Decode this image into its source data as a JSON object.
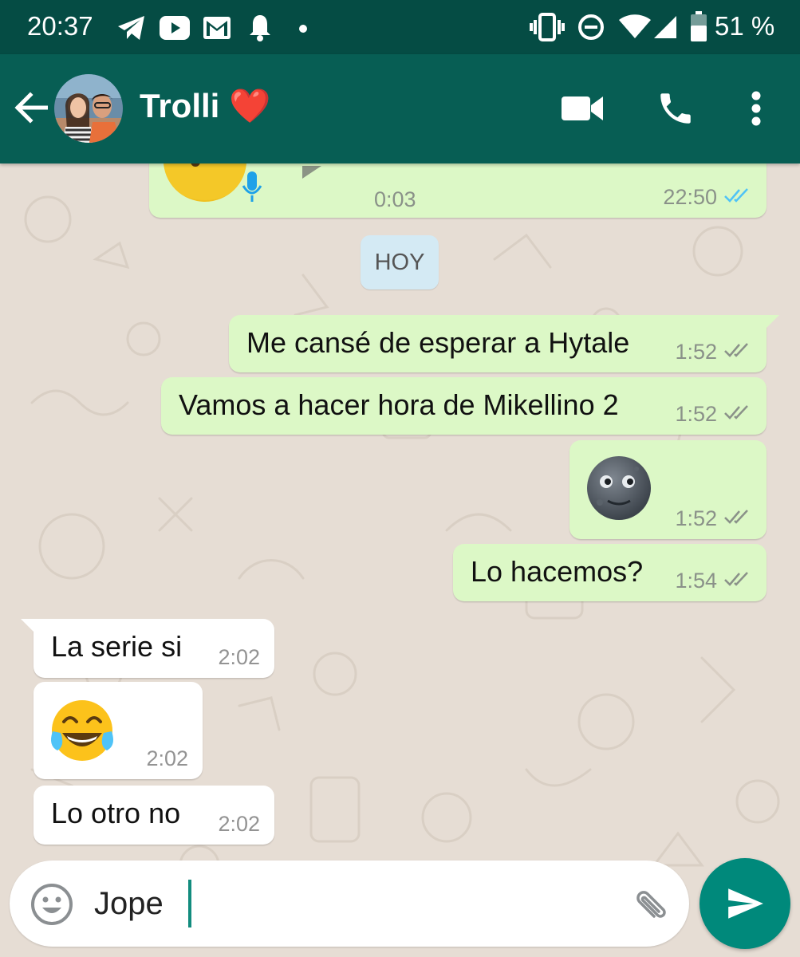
{
  "status_bar": {
    "time": "20:37",
    "battery": "51 %",
    "icons": [
      "telegram-icon",
      "youtube-icon",
      "gmail-icon",
      "bell-icon",
      "dot-icon",
      "vibrate-icon",
      "do-not-disturb-icon",
      "wifi-icon",
      "signal-icon",
      "battery-icon"
    ]
  },
  "header": {
    "contact_name": "Trolli",
    "contact_emoji": "❤️",
    "icons": [
      "back-arrow-icon",
      "video-call-icon",
      "phone-icon",
      "more-vert-icon"
    ]
  },
  "chat": {
    "voice_note": {
      "duration": "0:03",
      "time": "22:50",
      "status": "read"
    },
    "date_chip": "HOY",
    "messages": [
      {
        "direction": "outgoing",
        "text": "Me cansé de esperar a Hytale",
        "time": "1:52",
        "status": "delivered"
      },
      {
        "direction": "outgoing",
        "text": "Vamos a hacer hora de Mikellino 2",
        "time": "1:52",
        "status": "delivered"
      },
      {
        "direction": "outgoing",
        "emoji": "new-moon-face",
        "time": "1:52",
        "status": "delivered"
      },
      {
        "direction": "outgoing",
        "text": "Lo hacemos?",
        "time": "1:54",
        "status": "delivered"
      },
      {
        "direction": "incoming",
        "text": "La serie si",
        "time": "2:02"
      },
      {
        "direction": "incoming",
        "emoji": "face-with-tears-of-joy",
        "time": "2:02"
      },
      {
        "direction": "incoming",
        "text": "Lo otro no",
        "time": "2:02"
      }
    ]
  },
  "composer": {
    "value": "Jope",
    "icons": [
      "emoji-icon",
      "attach-icon",
      "send-icon"
    ]
  },
  "colors": {
    "header": "#075e54",
    "status_bar": "#054c44",
    "outgoing_bubble": "#dcf8c6",
    "incoming_bubble": "#ffffff",
    "wallpaper": "#e6ddd4",
    "read_ticks": "#4fc3f7",
    "send_button": "#00897b"
  }
}
